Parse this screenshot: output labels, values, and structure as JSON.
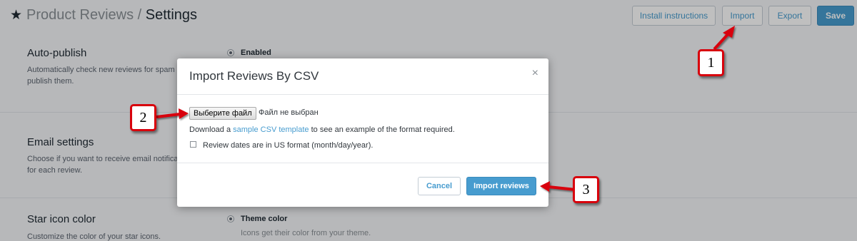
{
  "header": {
    "star_icon": "★",
    "app_title": "Product Reviews",
    "separator": " / ",
    "page_title": "Settings",
    "buttons": {
      "install": "Install instructions",
      "import": "Import",
      "export": "Export",
      "save": "Save"
    }
  },
  "sections": [
    {
      "title": "Auto-publish",
      "description": "Automatically check new reviews for spam and publish them.",
      "option_label": "Enabled",
      "option_help": ""
    },
    {
      "title": "Email settings",
      "description": "Choose if you want to receive email notifications for each review.",
      "option_label": "",
      "option_help": ""
    },
    {
      "title": "Star icon color",
      "description": "Customize the color of your star icons.",
      "option_label": "Theme color",
      "option_help": "Icons get their color from your theme."
    }
  ],
  "modal": {
    "title": "Import Reviews By CSV",
    "close_icon": "×",
    "file_button": "Выберите файл",
    "file_status": "Файл не выбран",
    "download_prefix": "Download a ",
    "download_link": "sample CSV template",
    "download_suffix": " to see an example of the format required.",
    "checkbox_label": "Review dates are in US format (month/day/year).",
    "cancel": "Cancel",
    "import": "Import reviews"
  },
  "callouts": [
    "1",
    "2",
    "3"
  ],
  "colors": {
    "accent": "#479ccf",
    "callout_border": "#d8000c"
  }
}
